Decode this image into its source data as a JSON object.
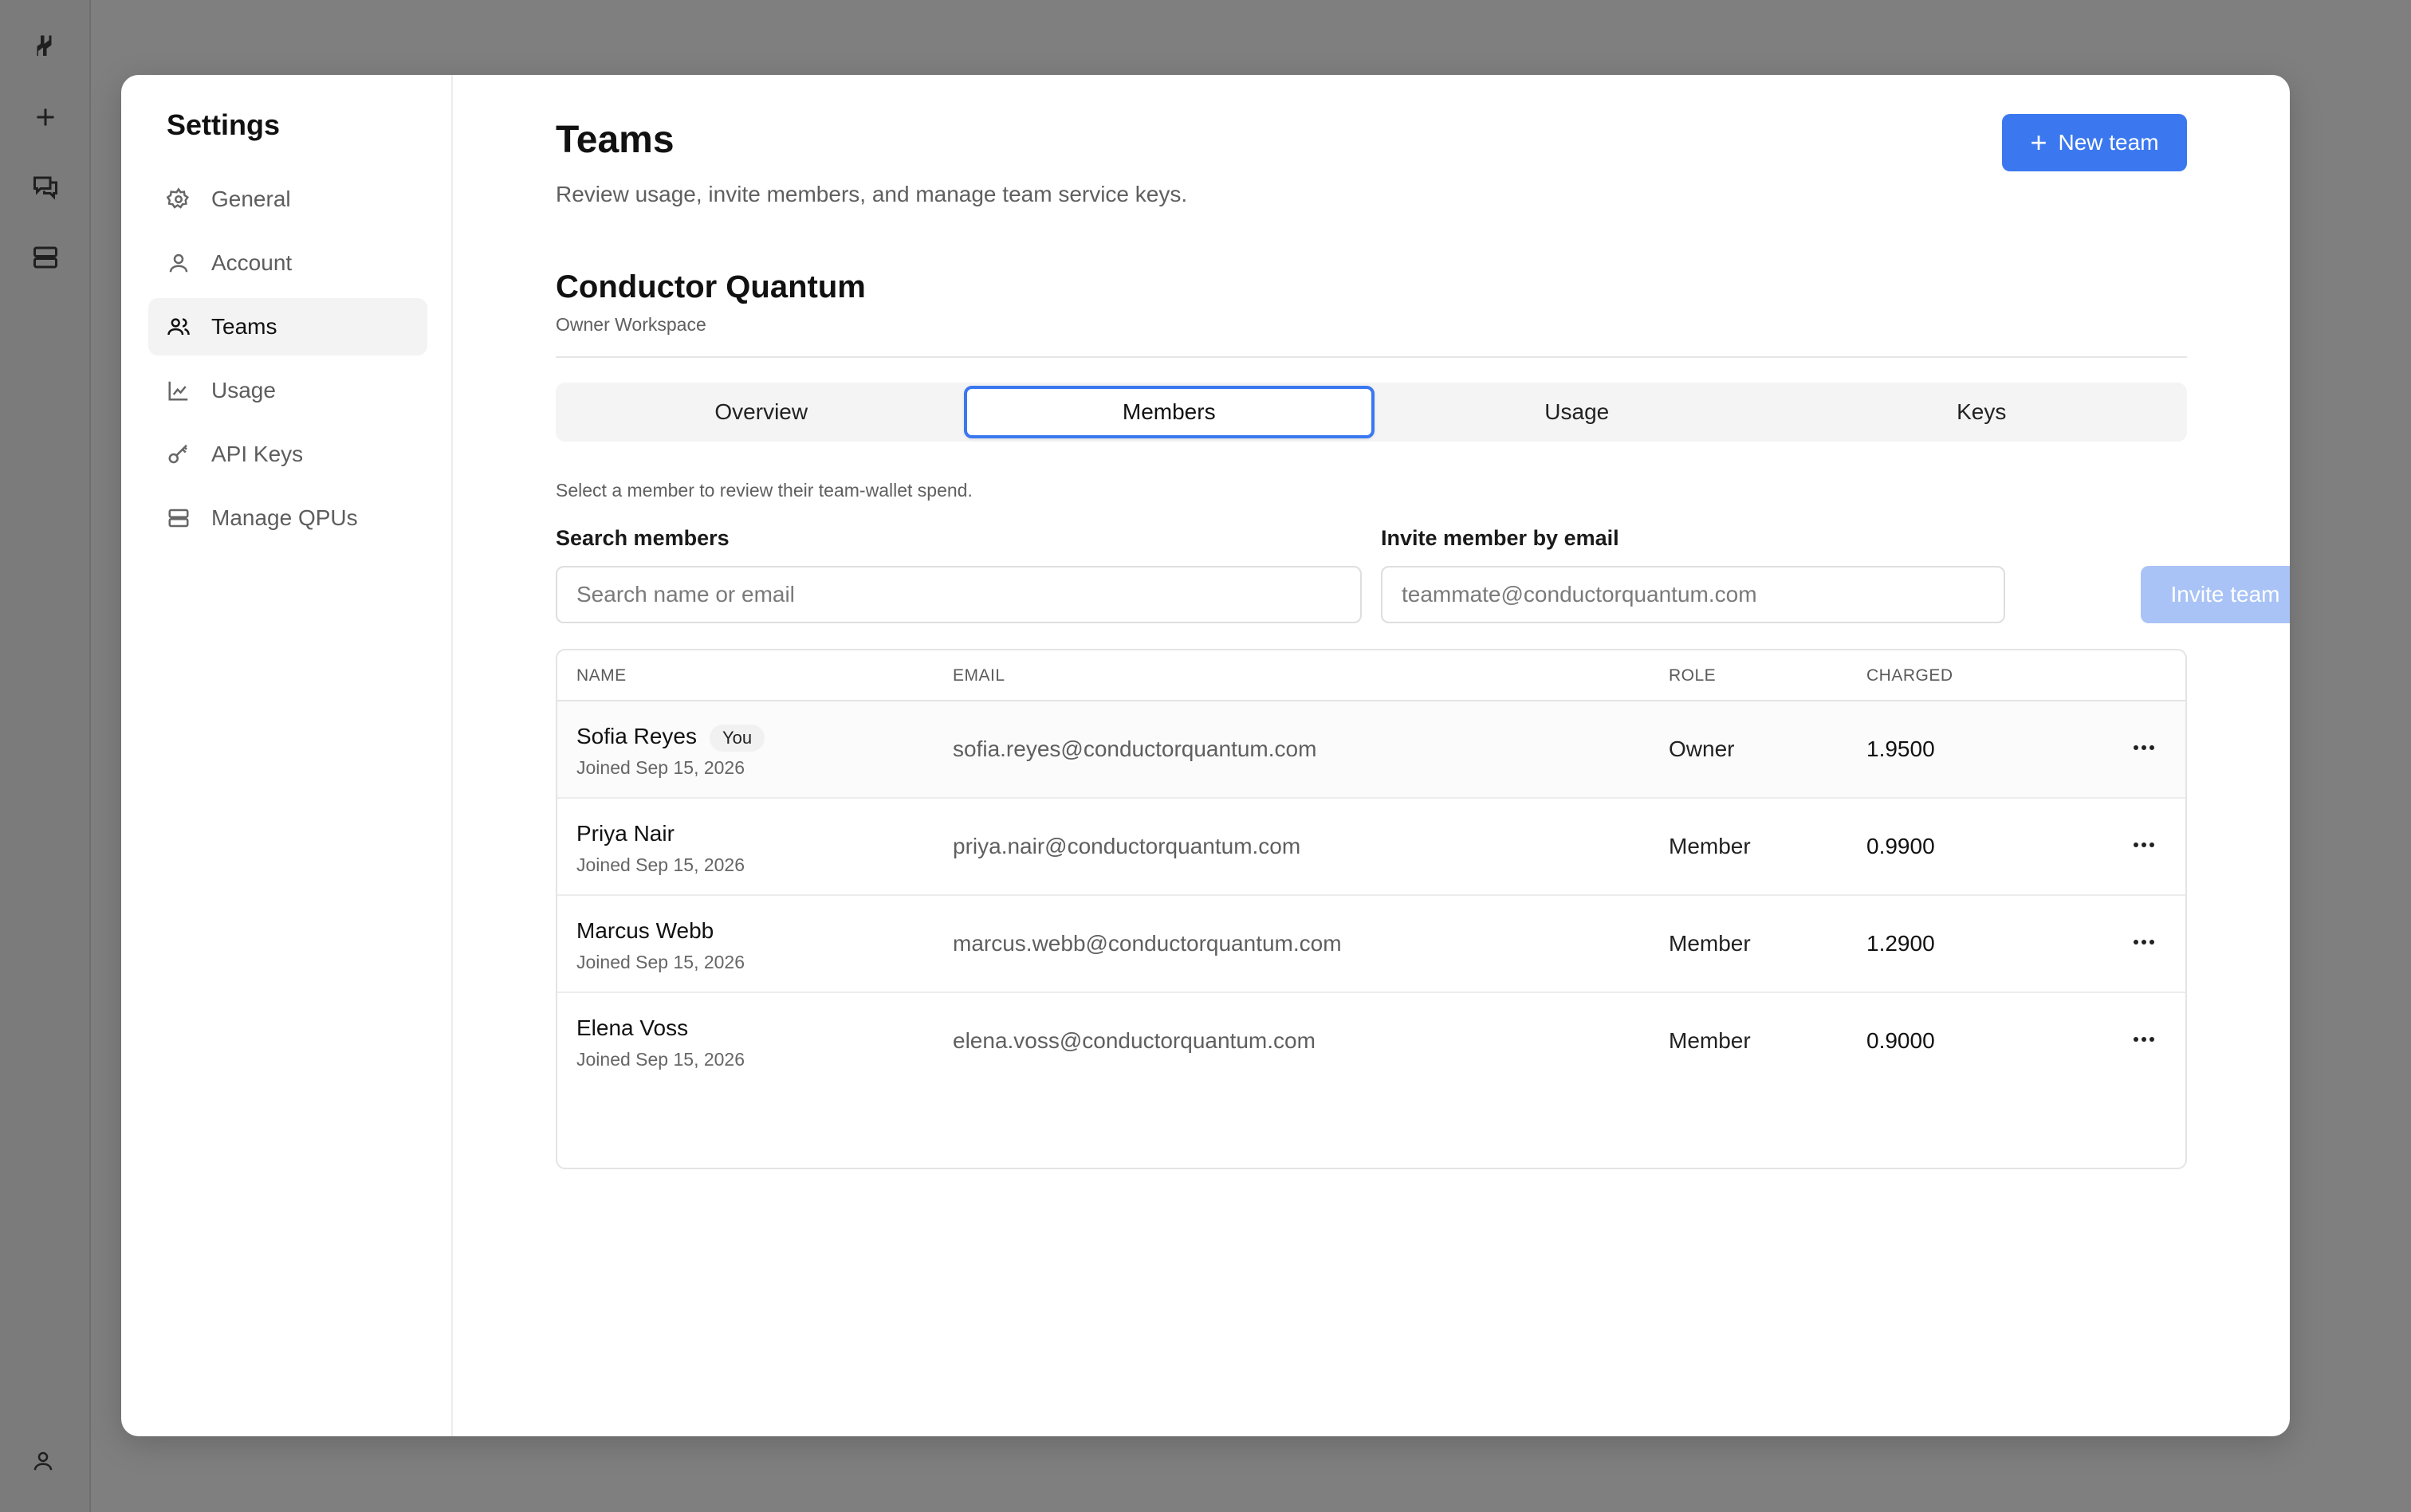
{
  "rail": {
    "icons": [
      "logo-icon",
      "plus-icon",
      "chat-icon",
      "server-icon",
      "user-icon"
    ]
  },
  "settings": {
    "title": "Settings",
    "nav": [
      {
        "label": "General",
        "icon": "gear-icon"
      },
      {
        "label": "Account",
        "icon": "user-icon"
      },
      {
        "label": "Teams",
        "icon": "users-icon",
        "active": true
      },
      {
        "label": "Usage",
        "icon": "chart-icon"
      },
      {
        "label": "API Keys",
        "icon": "key-icon"
      },
      {
        "label": "Manage QPUs",
        "icon": "server-icon"
      }
    ]
  },
  "header": {
    "title": "Teams",
    "subtitle": "Review usage, invite members, and manage team service keys.",
    "new_team_label": "New team"
  },
  "team": {
    "name": "Conductor Quantum",
    "subtitle": "Owner Workspace"
  },
  "tabs": [
    {
      "label": "Overview"
    },
    {
      "label": "Members",
      "active": true
    },
    {
      "label": "Usage"
    },
    {
      "label": "Keys"
    }
  ],
  "members": {
    "hint": "Select a member to review their team-wallet spend.",
    "search_label": "Search members",
    "search_placeholder": "Search name or email",
    "invite_label": "Invite member by email",
    "invite_placeholder": "teammate@conductorquantum.com",
    "invite_button": "Invite team",
    "columns": {
      "name": "NAME",
      "email": "EMAIL",
      "role": "ROLE",
      "charged": "CHARGED"
    },
    "rows": [
      {
        "name": "Sofia Reyes",
        "badge": "You",
        "joined": "Joined Sep 15, 2026",
        "email": "sofia.reyes@conductorquantum.com",
        "role": "Owner",
        "charged": "1.9500"
      },
      {
        "name": "Priya Nair",
        "joined": "Joined Sep 15, 2026",
        "email": "priya.nair@conductorquantum.com",
        "role": "Member",
        "charged": "0.9900"
      },
      {
        "name": "Marcus Webb",
        "joined": "Joined Sep 15, 2026",
        "email": "marcus.webb@conductorquantum.com",
        "role": "Member",
        "charged": "1.2900"
      },
      {
        "name": "Elena Voss",
        "joined": "Joined Sep 15, 2026",
        "email": "elena.voss@conductorquantum.com",
        "role": "Member",
        "charged": "0.9000"
      }
    ]
  },
  "colors": {
    "accent": "#3b78f0",
    "accent_disabled": "#a9c3f6",
    "overlay": "#7f7f7f"
  }
}
